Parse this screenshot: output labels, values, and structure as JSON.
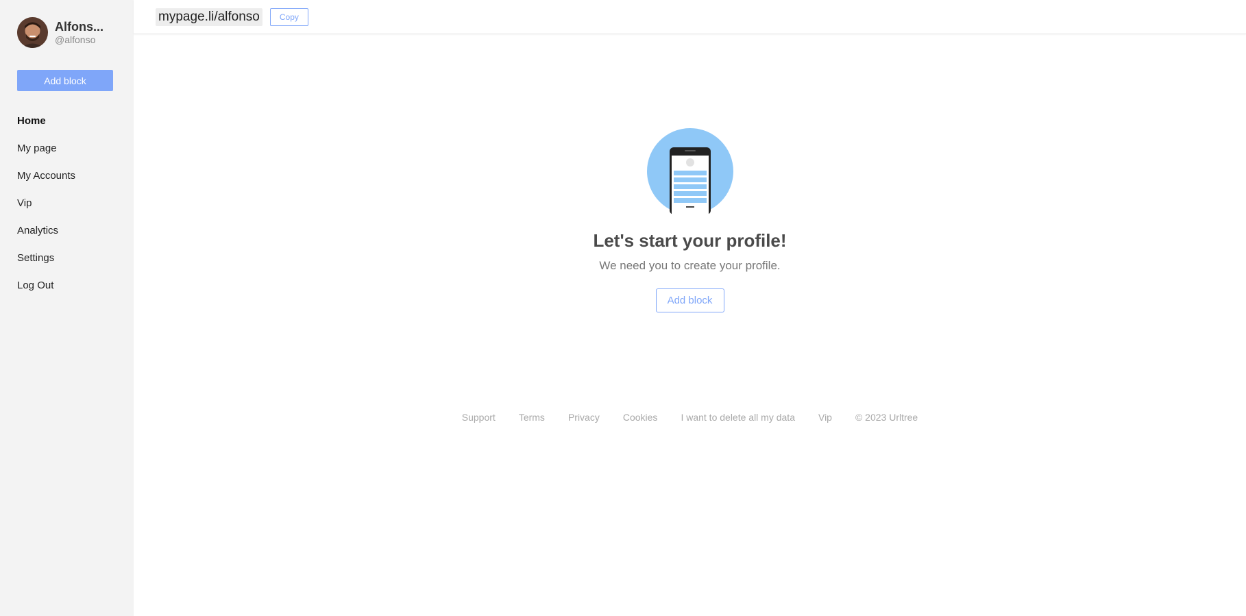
{
  "profile": {
    "name": "Alfons...",
    "handle": "@alfonso"
  },
  "sidebar": {
    "add_block_label": "Add block",
    "nav": [
      {
        "label": "Home",
        "active": true
      },
      {
        "label": "My page"
      },
      {
        "label": "My Accounts"
      },
      {
        "label": "Vip"
      },
      {
        "label": "Analytics"
      },
      {
        "label": "Settings"
      },
      {
        "label": "Log Out"
      }
    ]
  },
  "topbar": {
    "url": "mypage.li/alfonso",
    "copy_label": "Copy"
  },
  "empty_state": {
    "title": "Let's start your profile!",
    "subtitle": "We need you to create your profile.",
    "add_block_label": "Add block"
  },
  "footer": {
    "links": [
      "Support",
      "Terms",
      "Privacy",
      "Cookies",
      "I want to delete all my data",
      "Vip"
    ],
    "copyright": "© 2023 Urltree"
  },
  "colors": {
    "accent": "#7fa6f9",
    "sidebar_bg": "#f3f3f3",
    "illustration_circle": "#8fc8f7"
  }
}
